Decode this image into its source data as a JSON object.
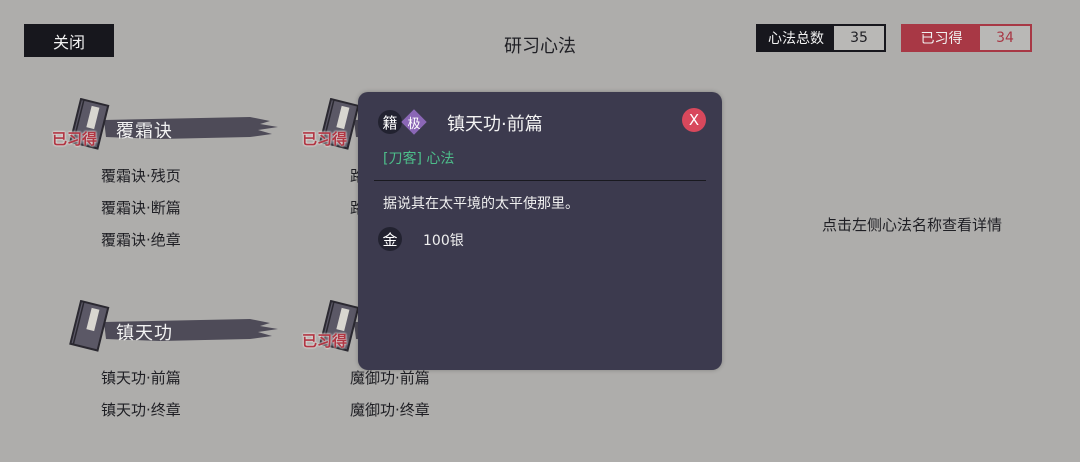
{
  "header": {
    "close_label": "关闭",
    "title": "研习心法",
    "total_label": "心法总数",
    "total_value": "35",
    "acquired_label": "已习得",
    "acquired_value": "34"
  },
  "acquired_badge": "已习得",
  "groups": [
    {
      "name": "覆霜诀",
      "badge": "已习得",
      "items": [
        "覆霜诀·残页",
        "覆霜诀·断篇",
        "覆霜诀·绝章"
      ]
    },
    {
      "name": "",
      "badge": "已习得",
      "items": [
        "路",
        "路"
      ]
    },
    {
      "name": "镇天功",
      "badge": "",
      "items": [
        "镇天功·前篇",
        "镇天功·终章"
      ]
    },
    {
      "name": "",
      "badge": "已习得",
      "items": [
        "魔御功·前篇",
        "魔御功·终章"
      ]
    }
  ],
  "hint": "点击左侧心法名称查看详情",
  "popup": {
    "type_icon": "籍",
    "grade": "极",
    "title": "镇天功·前篇",
    "close_label": "X",
    "tags": "[刀客] 心法",
    "description": "据说其在太平境的太平使那里。",
    "price_icon": "金",
    "price": "100银"
  },
  "colors": {
    "background": "#aeadab",
    "dark": "#17171d",
    "accent_red": "#a83845",
    "popup_bg": "#3c3a4e",
    "tag_green": "#4dbd8a",
    "grade_purple": "#8b67b6"
  }
}
